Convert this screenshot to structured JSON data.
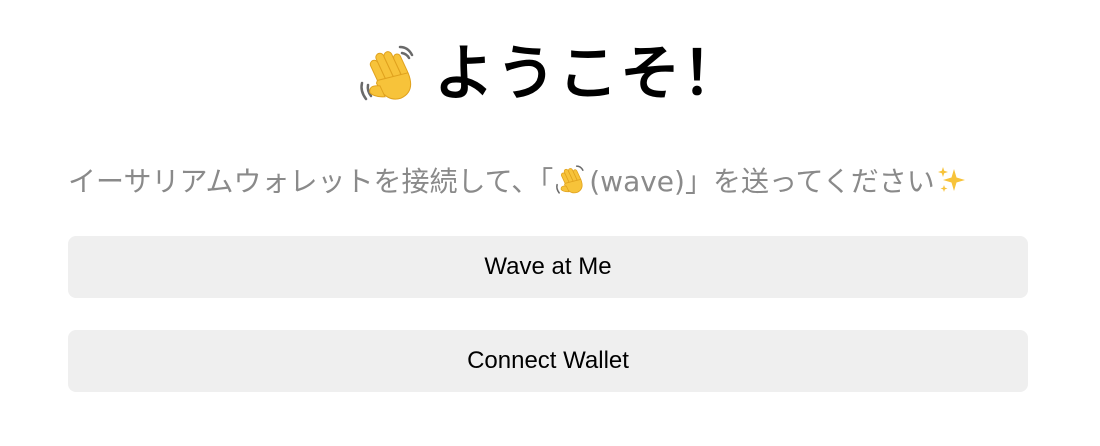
{
  "header": {
    "icon": "waving-hand-icon",
    "title": "ようこそ！"
  },
  "intro": {
    "text_before": "イーサリアムウォレットを接続して、「",
    "inline_icon": "waving-hand-icon",
    "text_after": "(wave)」を送ってください",
    "trailing_icon": "sparkles-icon"
  },
  "buttons": {
    "wave_label": "Wave at Me",
    "connect_label": "Connect Wallet"
  },
  "colors": {
    "emoji_yellow": "#F7C33A",
    "button_bg": "#EFEFEF",
    "subtitle_text": "#8A8A8A"
  }
}
